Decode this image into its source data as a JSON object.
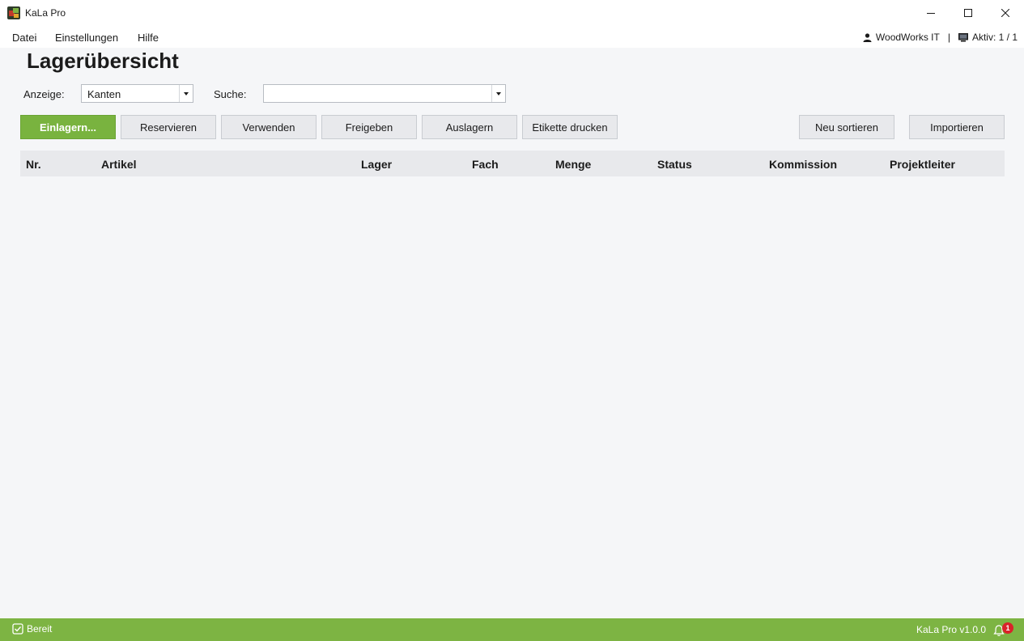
{
  "window": {
    "title": "KaLa Pro"
  },
  "menu": {
    "items": [
      "Datei",
      "Einstellungen",
      "Hilfe"
    ]
  },
  "user": {
    "name": "WoodWorks IT",
    "separator": "|",
    "active": "Aktiv: 1 / 1"
  },
  "page": {
    "title": "Lagerübersicht"
  },
  "filters": {
    "anzeige_label": "Anzeige:",
    "anzeige_value": "Kanten",
    "suche_label": "Suche:",
    "suche_value": ""
  },
  "toolbar": {
    "einlagern": "Einlagern...",
    "reservieren": "Reservieren",
    "verwenden": "Verwenden",
    "freigeben": "Freigeben",
    "auslagern": "Auslagern",
    "etikette": "Etikette drucken",
    "neu_sortieren": "Neu sortieren",
    "importieren": "Importieren"
  },
  "table": {
    "columns": [
      "Nr.",
      "Artikel",
      "Lager",
      "Fach",
      "Menge",
      "Status",
      "Kommission",
      "Projektleiter"
    ],
    "rows": []
  },
  "status": {
    "text": "Bereit",
    "version": "KaLa Pro v1.0.0",
    "notifications": "1"
  },
  "colors": {
    "accent": "#7db443",
    "badge": "#d9232a"
  },
  "icons": {
    "user": "user-icon",
    "monitor": "monitor-icon",
    "status": "checkbox-icon",
    "notifications": "bell-icon"
  }
}
